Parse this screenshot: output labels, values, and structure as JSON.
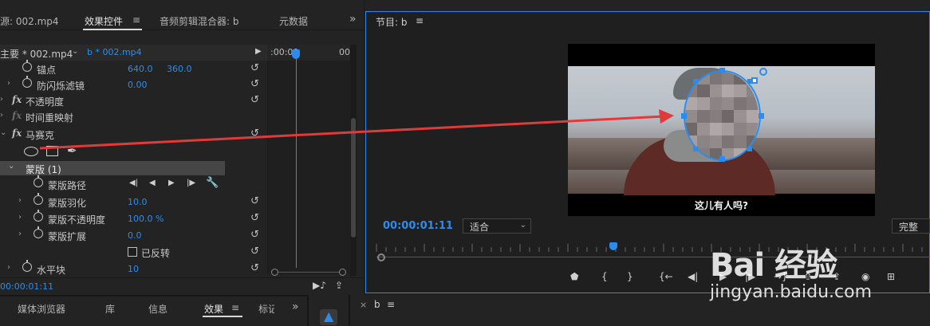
{
  "top_tabs": {
    "source": "源: 002.mp4",
    "effect_controls": "效果控件",
    "audio_mixer": "音频剪辑混合器: b",
    "metadata": "元数据",
    "overflow": "»"
  },
  "effect_controls": {
    "master_clip": "主要 * 002.mp4",
    "sequence_clip": "b * 002.mp4",
    "ruler_start": ":00:00",
    "ruler_end": "00",
    "anchor_label": "锚点",
    "anchor_x": "640.0",
    "anchor_y": "360.0",
    "flicker_label": "防闪烁滤镜",
    "flicker_value": "0.00",
    "opacity_label": "不透明度",
    "time_remap_label": "时间重映射",
    "mosaic_label": "马赛克",
    "mask_label": "蒙版 (1)",
    "mask_path_label": "蒙版路径",
    "mask_feather_label": "蒙版羽化",
    "mask_feather_value": "10.0",
    "mask_opacity_label": "蒙版不透明度",
    "mask_opacity_value": "100.0 %",
    "mask_expansion_label": "蒙版扩展",
    "mask_expansion_value": "0.0",
    "inverted_label": "已反转",
    "horizontal_blocks_label": "水平块",
    "horizontal_blocks_value": "10",
    "footer_time": "00:00:01:11"
  },
  "bottom_left_tabs": {
    "media_browser": "媒体浏览器",
    "library": "库",
    "info": "信息",
    "effects": "效果",
    "markers": "标记",
    "overflow": "»"
  },
  "program_monitor": {
    "title": "节目: b",
    "subtitle": "这儿有人吗?",
    "timecode": "00:00:01:11",
    "fit_option": "适合",
    "quality_option": "完整"
  },
  "sequence_panel": {
    "tab": "b"
  },
  "watermark": {
    "line1": "Bai 经验",
    "line2": "jingyan.baidu.com"
  },
  "colors": {
    "accent": "#2d8ceb",
    "panel": "#232323",
    "arrow": "#e03a3a"
  }
}
